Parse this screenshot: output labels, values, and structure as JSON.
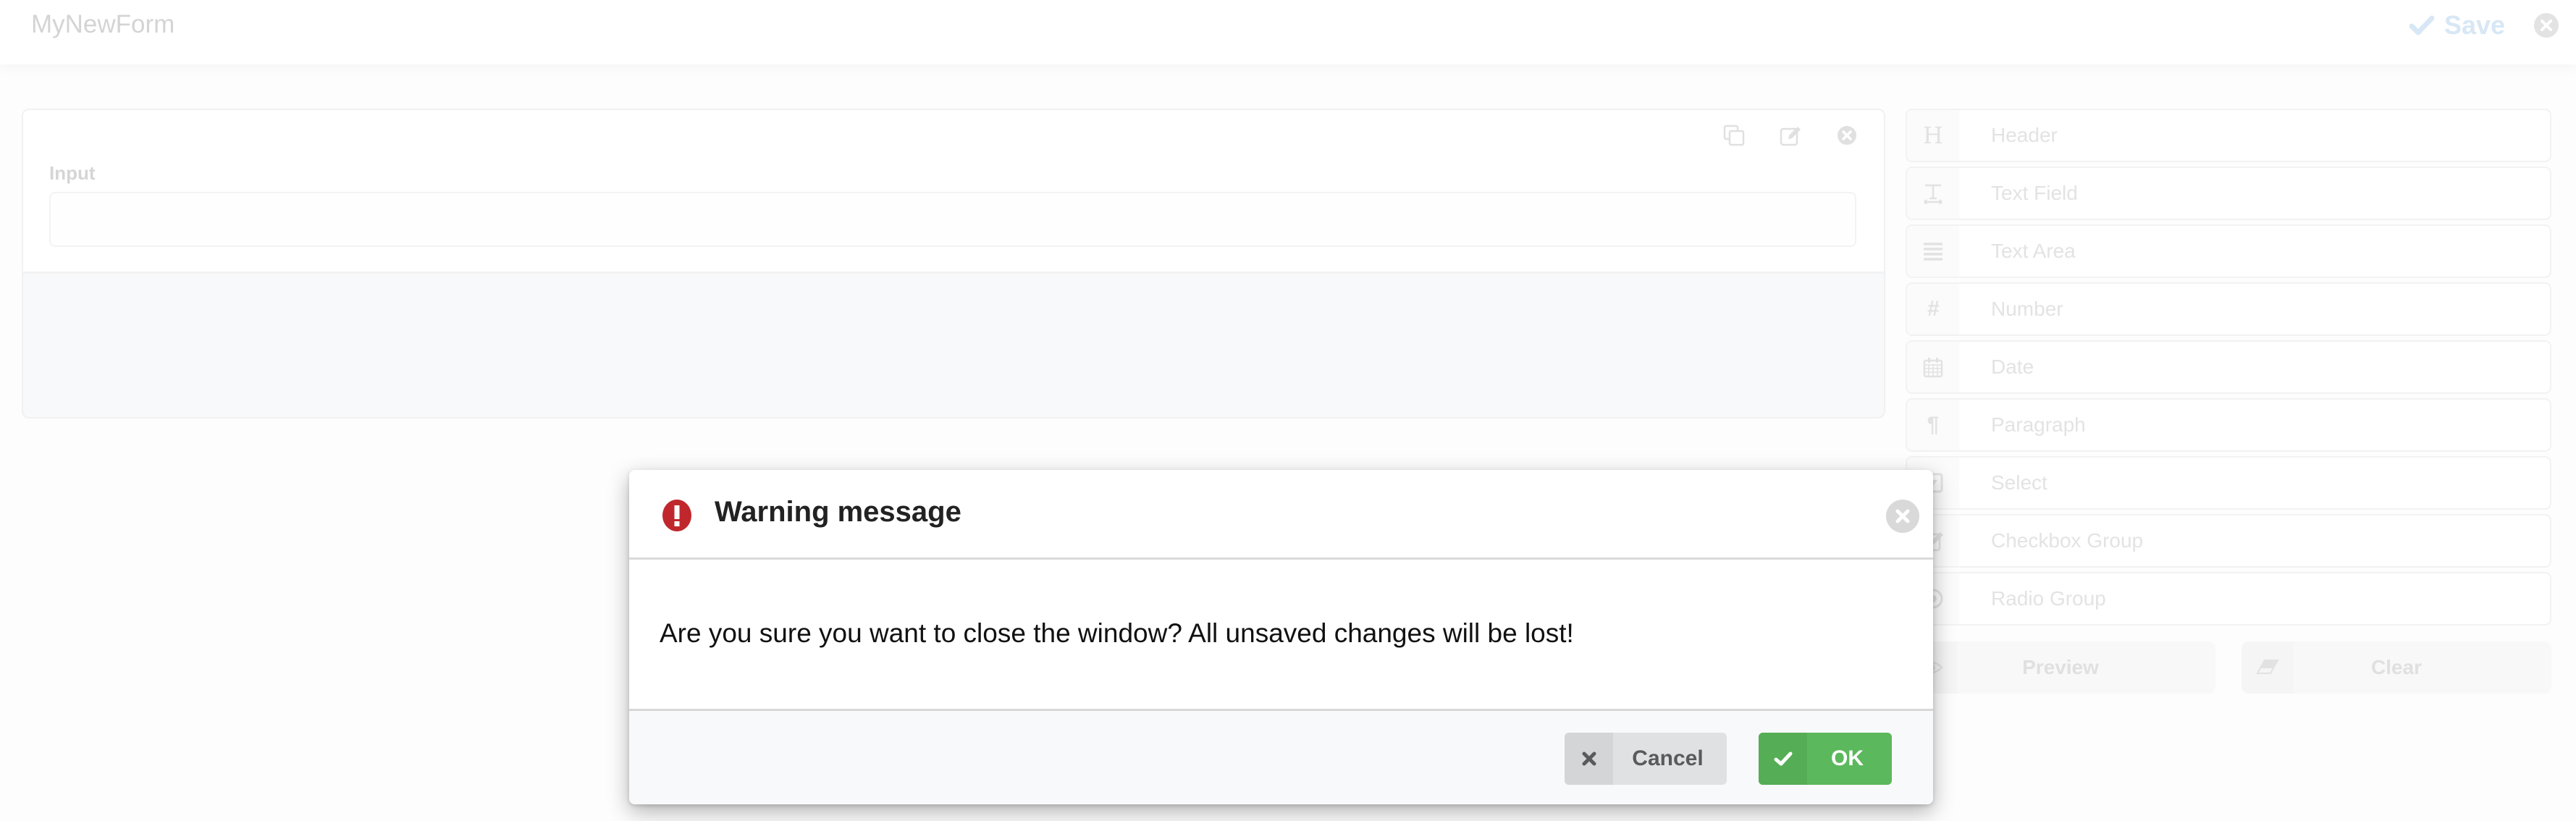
{
  "app": {
    "title": "MyNewForm",
    "save_label": "Save",
    "close_icon": "circle-x-icon"
  },
  "canvas": {
    "field": {
      "label": "Input",
      "value": "",
      "actions": [
        "copy-icon",
        "edit-icon",
        "remove-icon"
      ]
    }
  },
  "palette": {
    "items": [
      {
        "label": "Header",
        "icon": "header-icon"
      },
      {
        "label": "Text Field",
        "icon": "text-field-icon"
      },
      {
        "label": "Text Area",
        "icon": "text-area-icon"
      },
      {
        "label": "Number",
        "icon": "hash-icon"
      },
      {
        "label": "Date",
        "icon": "calendar-icon"
      },
      {
        "label": "Paragraph",
        "icon": "paragraph-icon"
      },
      {
        "label": "Select",
        "icon": "select-icon"
      },
      {
        "label": "Checkbox Group",
        "icon": "checkbox-icon"
      },
      {
        "label": "Radio Group",
        "icon": "radio-icon"
      }
    ],
    "preview_label": "Preview",
    "clear_label": "Clear"
  },
  "modal": {
    "title": "Warning message",
    "icon": "exclamation-circle-icon",
    "message": "Are you sure you want to close the window? All unsaved changes will be lost!",
    "cancel_label": "Cancel",
    "ok_label": "OK",
    "colors": {
      "warning": "#c0272d",
      "ok": "#5cb85c",
      "cancel": "#e0e1e2"
    }
  }
}
